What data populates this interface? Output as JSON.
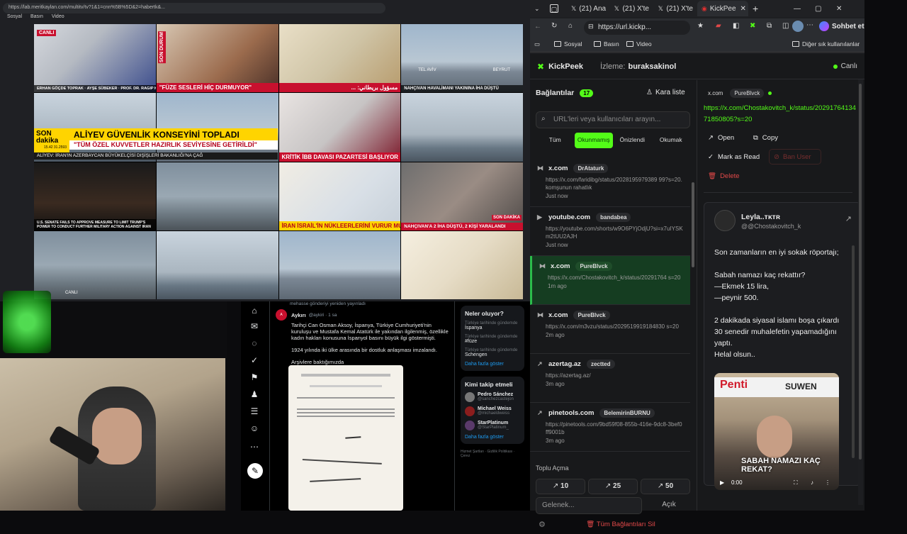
{
  "bg_browser": {
    "url": "https://lab.meritkaylan.com/multitv/tv?1&1=cnn%5B%5D&2=habertk&...",
    "bookmarks": [
      "Sosyal",
      "Basın",
      "Video"
    ]
  },
  "news_wall": {
    "t1_cap": "ERHAN GÖÇDE TOPRAK · AYŞE SÜBEKER · PROF. DR. RAGIP KUTAY KARACA",
    "t1_badge": "CANLI",
    "t2_cap": "\"FÜZE SESLERİ HİÇ DURMUYOR\"",
    "t2_badge": "SON DURUM",
    "t3_cap": "مسؤول بريطاني: ...",
    "t4_cap": "NAHÇIVAN HAVALİMANI YAKININA İHA DÜŞTÜ",
    "t4_places": [
      "TEL AVİV",
      "BEYRUT"
    ],
    "t5_banner": "ALİYEV GÜVENLİK KONSEYİNİ TOPLADI",
    "t5_sub": "\"TÜM ÖZEL KUVVETLER HAZIRLIK SEVİYESİNE GETİRİLDİ\"",
    "t5_ticker": "ALİYEV: İRAN'IN AZERBAYCAN BÜYÜKELÇİSİ DIŞİŞLERİ BAKANLIĞI'NA ÇAĞ",
    "t5_sonlabel": "SON dakika",
    "t5_index": "15.42  31.2593",
    "t6_cap": "KRİTİK İBB DAVASI PAZARTESİ BAŞLIYOR",
    "t7_cap": "U.S. SENATE FAILS TO APPROVE MEASURE TO LIMIT TRUMP'S POWER TO CONDUCT FURTHER MILITARY ACTION AGAINST IRAN",
    "t9_cap": "İRAN İSRAİL'İN NÜKLEERLERİNİ VURUR MU?",
    "t10_cap": "NAHÇIVAN'A 2 İHA DÜŞTÜ, 2 KİŞİ YARALANDI",
    "t10_badge": "SON DAKİKA",
    "t13_label": "CANLI"
  },
  "twitter": {
    "context": "mehasse gönderiyi yeniden yayınladı",
    "author": "Aykırı",
    "handle": "@aykiri · 1 sa",
    "body": "Tarihçi Can Osman Aksoy, İspanya, Türkiye Cumhuriyeti'nin kuruluşu ve Mustafa Kemal Atatürk ile yakından ilgilenmiş, özellikle kadın hakları konusuna İspanyol basını büyük ilgi göstermişti.",
    "body2": "1924 yılında iki ülke arasında bir dostluk anlaşması imzalandı.",
    "body3": "Arşivlere baktığımızda",
    "more": "Daha fazla göster",
    "trends_title": "Neler oluyor?",
    "trends": [
      {
        "context": "Türkiye tarihinde gündemde",
        "name": "İspanya"
      },
      {
        "context": "Türkiye tarihinde gündemde",
        "name": "#füze"
      },
      {
        "context": "Türkiye tarihinde gündemde",
        "name": "Schengen"
      }
    ],
    "trends_more": "Daha fazla göster",
    "follow_title": "Kimi takip etmeli",
    "follow": [
      {
        "name": "Pedro Sánchez",
        "handle": "@sanchezcastejon"
      },
      {
        "name": "Michael Weiss",
        "handle": "@michaeldweiss"
      },
      {
        "name": "StarPlatinum",
        "handle": "@StarPlatinum_"
      }
    ],
    "follow_more": "Daha fazla göster",
    "footer": [
      "Hizmet Şartları",
      "Gizlilik Politikası",
      "Çerez"
    ]
  },
  "edge": {
    "tabs": [
      {
        "icon": "twitch",
        "label": ""
      },
      {
        "icon": "x",
        "label": "(21) Ana"
      },
      {
        "icon": "x",
        "label": "(21) X'te"
      },
      {
        "icon": "x",
        "label": "(21) X'te"
      },
      {
        "icon": "kick",
        "label": "KickPee"
      }
    ],
    "url": "https://url.kickp...",
    "chat_label": "Sohbet et",
    "bookmarks": [
      "Sosyal",
      "Basın",
      "Video"
    ],
    "other_bookmarks": "Diğer sık kullanılanlar"
  },
  "kickpeek": {
    "brand": "KickPeek",
    "watching_label": "İzleme:",
    "watching_user": "buraksakinol",
    "live_label": "Canlı",
    "connections_label": "Bağlantılar",
    "connections_count": "17",
    "blacklist_label": "Kara liste",
    "search_placeholder": "URL'leri veya kullanıcıları arayın...",
    "filters": [
      "Tüm",
      "Okunmamış",
      "Önizlendi",
      "Okumak"
    ],
    "connections": [
      {
        "icon": "x",
        "domain": "x.com",
        "user": "DrAtaturk",
        "url": "https://x.com/faridibg/status/2028195979389 99?s=20. komşunun rahatlık",
        "time": "Just now"
      },
      {
        "icon": "youtube",
        "domain": "youtube.com",
        "user": "bandabea",
        "url": "https://youtube.com/shorts/w9O6PYjOdjU?si=x7uIYSKm2tUU2AJH",
        "time": "Just now"
      },
      {
        "icon": "x",
        "domain": "x.com",
        "user": "PureBlvck",
        "url": "https://x.com/Chostakovitch_k/status/20291764 s=20",
        "time": "1m ago"
      },
      {
        "icon": "x",
        "domain": "x.com",
        "user": "PureBlvck",
        "url": "https://x.com/m3vzu/status/2029519919184830 s=20",
        "time": "2m ago"
      },
      {
        "icon": "link",
        "domain": "azertag.az",
        "user": "zectted",
        "url": "https://azertag.az/",
        "time": "3m ago"
      },
      {
        "icon": "link",
        "domain": "pinetools.com",
        "user": "BelemirinBURNU",
        "url": "https://pinetools.com/9bd59f08-855b-416e-9dc8-3bef0ff9001b",
        "time": "3m ago"
      }
    ],
    "bulk_label": "Toplu Açma",
    "bulk_buttons": [
      "10",
      "25",
      "50"
    ],
    "goto_placeholder": "Gelenek...",
    "open_label": "Açık",
    "clear_label": "Tüm Bağlantıları Sil",
    "detail": {
      "domain": "x.com",
      "user": "PureBlvck",
      "url": "https://x.com/Chostakovitch_k/status/2029176413471850805?s=20",
      "open": "Open",
      "copy": "Copy",
      "mark_read": "Mark as Read",
      "ban_user": "Ban User",
      "delete": "Delete",
      "tweet_author": "Leyla..ᴛᴋᴛʀ",
      "tweet_handle": "@@Chostakovitch_k",
      "tweet_text": "Son zamanların en iyi sokak röportajı;\n\nSabah namazı kaç rekattır?\n—Ekmek 15 lira,\n—peynir 500.\n\n2 dakikada siyasal islamı boşa çıkardı\n30 senedir muhalefetin yapamadığını yaptı.\nHelal olsun..",
      "video_time": "0:00",
      "video_shop_1": "Penti",
      "video_shop_2": "SUWEN",
      "video_caption": "SABAH NAMAZI KAÇ REKAT?"
    }
  },
  "colors": {
    "kick_green": "#53fc18",
    "danger": "#e04848",
    "x_blue": "#1d9bf0"
  }
}
